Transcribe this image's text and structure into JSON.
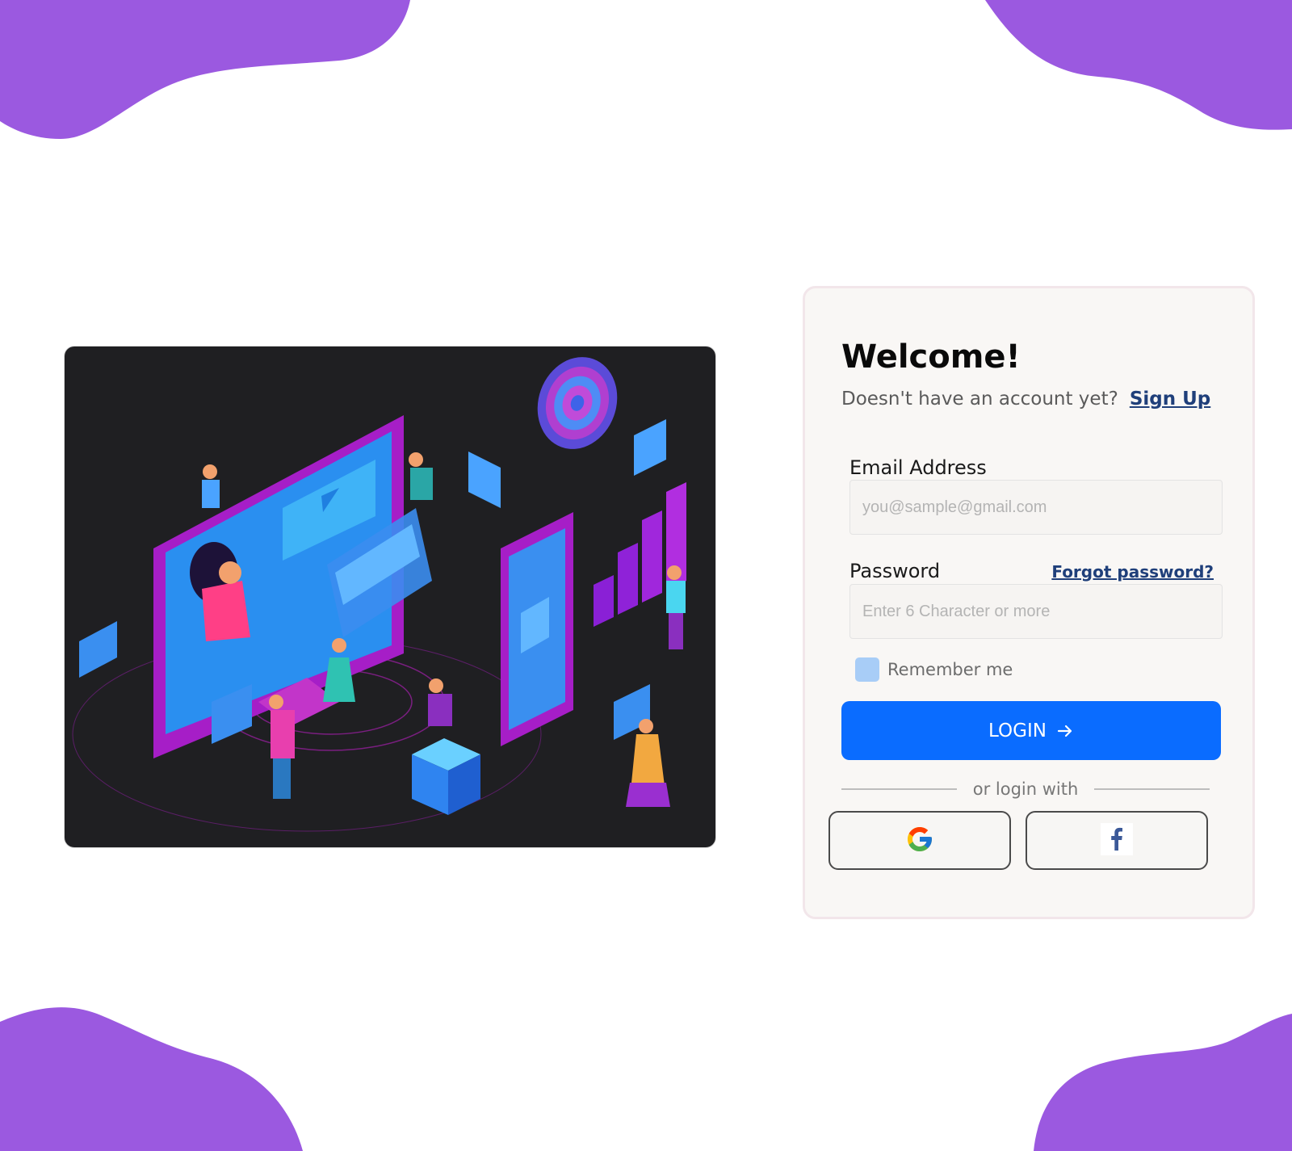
{
  "colors": {
    "blob": "#9b59e0",
    "primary": "#0a6cff",
    "link": "#1f3f7a",
    "card_bg": "#f9f7f5",
    "checkbox": "#a8cdf7"
  },
  "illustration": {
    "icon": "isometric-digital-marketing-illustration"
  },
  "login": {
    "title": "Welcome!",
    "signup_prompt": "Doesn't have an account yet?",
    "signup_link": "Sign Up",
    "email_label": "Email Address",
    "email_placeholder": "you@sample@gmail.com",
    "password_label": "Password",
    "forgot_link": "Forgot password?",
    "password_placeholder": "Enter 6 Character or more",
    "remember_label": "Remember me",
    "login_button": "LOGIN",
    "divider_text": "or login with",
    "social": {
      "google_icon": "google-icon",
      "facebook_icon": "facebook-icon"
    }
  }
}
